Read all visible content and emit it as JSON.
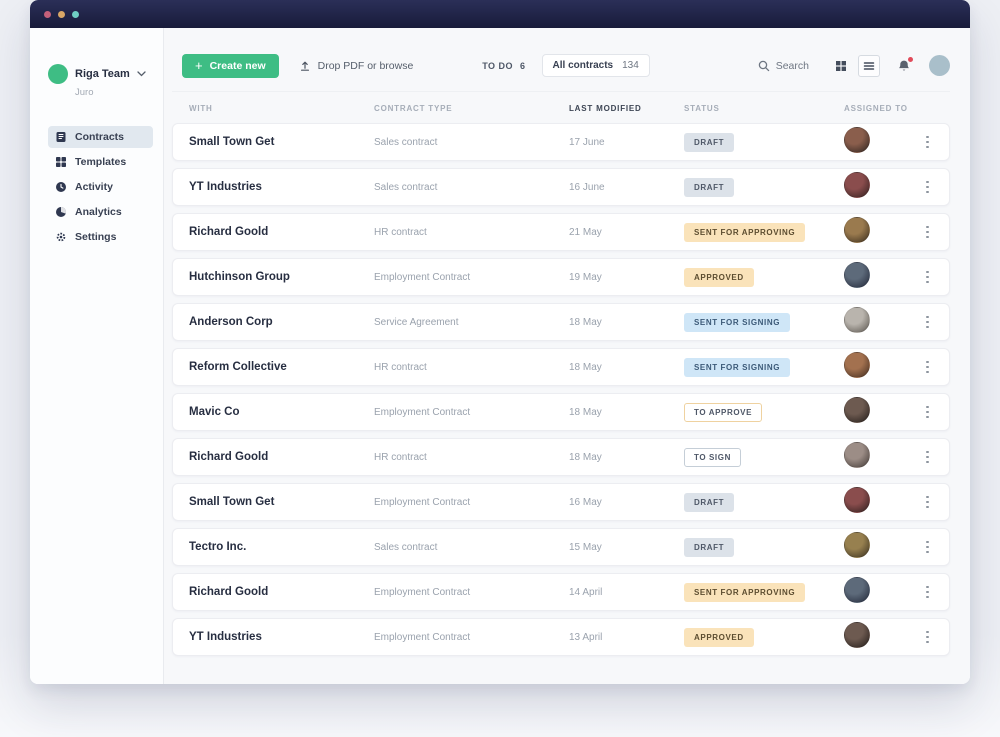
{
  "titlebar": {
    "dots": [
      "#c4607a",
      "#d9a766",
      "#6fcec3"
    ]
  },
  "sidebar": {
    "team": {
      "name": "Riga Team",
      "org": "Juro"
    },
    "items": [
      {
        "label": "Contracts",
        "icon": "contracts-icon",
        "active": true
      },
      {
        "label": "Templates",
        "icon": "templates-icon",
        "active": false
      },
      {
        "label": "Activity",
        "icon": "activity-icon",
        "active": false
      },
      {
        "label": "Analytics",
        "icon": "analytics-icon",
        "active": false
      },
      {
        "label": "Settings",
        "icon": "settings-icon",
        "active": false
      }
    ]
  },
  "toolbar": {
    "create_new": "Create new",
    "drop_pdf": "Drop PDF or browse",
    "todo": {
      "label": "TO DO",
      "count": "6"
    },
    "filter": {
      "label": "All contracts",
      "count": "134"
    },
    "search": "Search"
  },
  "table": {
    "columns": [
      "WITH",
      "CONTRACT TYPE",
      "LAST MODIFIED",
      "STATUS",
      "ASSIGNED TO"
    ],
    "sorted_column": "LAST MODIFIED",
    "rows": [
      {
        "with": "Small Town Get",
        "type": "Sales contract",
        "modified": "17 June",
        "status": "DRAFT",
        "status_style": "draft",
        "avatar": [
          "#8a5e4c",
          "#2e2420"
        ]
      },
      {
        "with": "YT Industries",
        "type": "Sales contract",
        "modified": "16 June",
        "status": "DRAFT",
        "status_style": "draft",
        "avatar": [
          "#8a4d4d",
          "#32201f"
        ]
      },
      {
        "with": "Richard Goold",
        "type": "HR contract",
        "modified": "21 May",
        "status": "SENT FOR APPROVING",
        "status_style": "amber",
        "avatar": [
          "#9a7a4e",
          "#3a2d1d"
        ]
      },
      {
        "with": "Hutchinson Group",
        "type": "Employment Contract",
        "modified": "19 May",
        "status": "APPROVED",
        "status_style": "amber",
        "avatar": [
          "#5d6a7a",
          "#23293a"
        ]
      },
      {
        "with": "Anderson Corp",
        "type": "Service Agreement",
        "modified": "18 May",
        "status": "SENT FOR SIGNING",
        "status_style": "blue",
        "avatar": [
          "#b9b4ad",
          "#5a554e"
        ]
      },
      {
        "with": "Reform Collective",
        "type": "HR contract",
        "modified": "18 May",
        "status": "SENT FOR SIGNING",
        "status_style": "blue",
        "avatar": [
          "#a3714f",
          "#432d20"
        ]
      },
      {
        "with": "Mavic Co",
        "type": "Employment Contract",
        "modified": "18 May",
        "status": "TO APPROVE",
        "status_style": "outline-amber",
        "avatar": [
          "#6d5a50",
          "#241d1a"
        ]
      },
      {
        "with": "Richard Goold",
        "type": "HR contract",
        "modified": "18 May",
        "status": "TO SIGN",
        "status_style": "outline-gray",
        "avatar": [
          "#9c8d86",
          "#423a36"
        ]
      },
      {
        "with": "Small Town Get",
        "type": "Employment Contract",
        "modified": "16 May",
        "status": "DRAFT",
        "status_style": "draft",
        "avatar": [
          "#8a4d4d",
          "#2e1f1e"
        ]
      },
      {
        "with": "Tectro Inc.",
        "type": "Sales contract",
        "modified": "15 May",
        "status": "DRAFT",
        "status_style": "draft",
        "avatar": [
          "#97804f",
          "#3a3120"
        ]
      },
      {
        "with": "Richard Goold",
        "type": "Employment Contract",
        "modified": "14 April",
        "status": "SENT FOR APPROVING",
        "status_style": "amber",
        "avatar": [
          "#5d6a7a",
          "#23293a"
        ]
      },
      {
        "with": "YT Industries",
        "type": "Employment Contract",
        "modified": "13 April",
        "status": "APPROVED",
        "status_style": "amber",
        "avatar": [
          "#6d5a50",
          "#241d1a"
        ]
      }
    ]
  },
  "colors": {
    "accent_green": "#3ebd84",
    "topbar": "#1d2040",
    "badge_draft_bg": "#dce2e9",
    "badge_amber_bg": "#fae3ba",
    "badge_blue_bg": "#cfe6f7",
    "badge_outline_amber_border": "#efd2a0",
    "badge_outline_gray_border": "#c5ced7",
    "notification_dot": "#e14b5a"
  }
}
